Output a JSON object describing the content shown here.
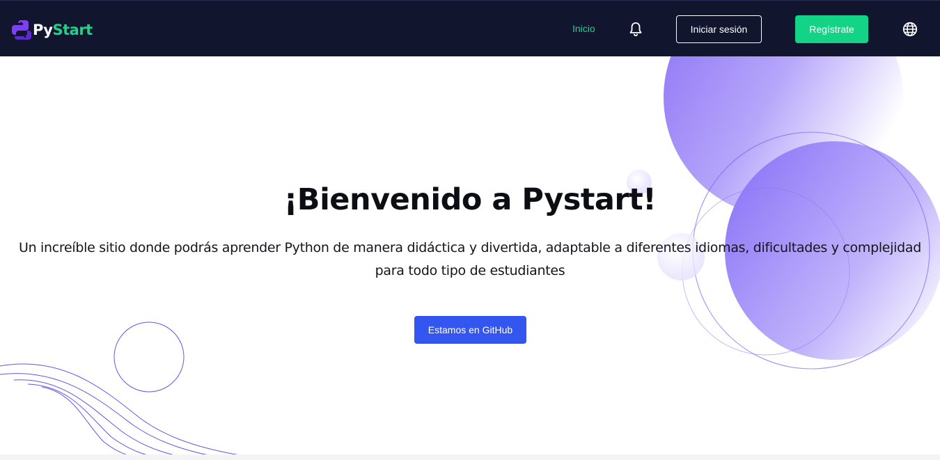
{
  "navbar": {
    "logo": {
      "part1": "Py",
      "part2": "Start",
      "icon": "python-logo-icon"
    },
    "links": {
      "home_label": "Inicio"
    },
    "icons": {
      "notifications": "bell-icon",
      "language": "globe-icon"
    },
    "buttons": {
      "login_label": "Iniciar sesión",
      "register_label": "Regístrate"
    }
  },
  "hero": {
    "title": "¡Bienvenido a Pystart!",
    "subtitle": "Un increíble sitio donde podrás aprender Python de manera didáctica y divertida, adaptable a diferentes idiomas, dificultades y complejidad para todo tipo de estudiantes",
    "github_button_label": "Estamos en GitHub"
  },
  "colors": {
    "navbar_bg": "#11152e",
    "brand_green": "#1ed388",
    "register_button": "#13d486",
    "github_button": "#3356f0",
    "decor_purple": "#7b61f5"
  }
}
